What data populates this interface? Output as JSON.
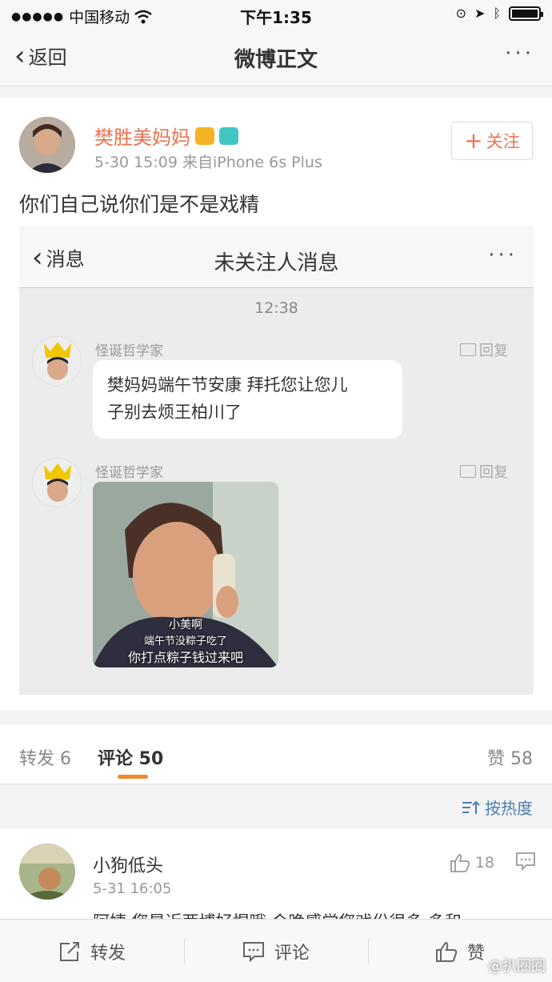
{
  "status_bar": {
    "carrier": "中国移动",
    "time": "下午1:35"
  },
  "nav": {
    "back_label": "返回",
    "title": "微博正文",
    "more": "···"
  },
  "post": {
    "author": "樊胜美妈妈",
    "time": "5-30 15:09",
    "source": "来自iPhone 6s Plus",
    "follow_label": "关注",
    "text": "你们自己说你们是不是戏精"
  },
  "screenshot": {
    "back_label": "消息",
    "title": "未关注人消息",
    "more": "···",
    "time": "12:38",
    "messages": [
      {
        "sender": "怪诞哲学家",
        "reply_label": "回复",
        "text_line1": "樊妈妈端午节安康 拜托您让您儿",
        "text_line2": "子别去烦王柏川了"
      },
      {
        "sender": "怪诞哲学家",
        "reply_label": "回复",
        "caption1": "小美啊",
        "caption2": "端午节没粽子吃了",
        "caption3": "你打点粽子钱过来吧"
      }
    ]
  },
  "tabs": {
    "repost": "转发 6",
    "comment": "评论 50",
    "like": "赞 58"
  },
  "sort_label": "按热度",
  "comment": {
    "name": "小狗低头",
    "time": "5-31 16:05",
    "likes": "18",
    "text": "阿姨 您是近两博好惺哦 会晚感觉您戏份很多 多和"
  },
  "bottom_bar": {
    "repost": "转发",
    "comment": "评论",
    "like": "赞"
  },
  "watermark": "@扒圈圈",
  "colors": {
    "orange": "#eb7350",
    "link_blue": "#4a7db5",
    "tab_underline": "#f08a2c"
  }
}
